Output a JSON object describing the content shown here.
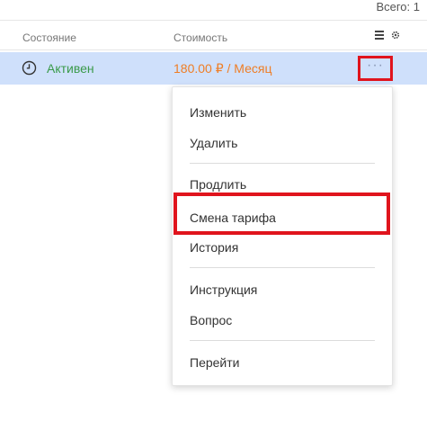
{
  "summary": {
    "total_label": "Всего: 1"
  },
  "table": {
    "headers": {
      "state": "Состояние",
      "cost": "Стоимость"
    },
    "rows": [
      {
        "status": "Активен",
        "price": "180.00 ₽ / Месяц"
      }
    ]
  },
  "row_actions": {
    "more_label": "···"
  },
  "context_menu": {
    "items": [
      "Изменить",
      "Удалить",
      "Продлить",
      "Смена тарифа",
      "История",
      "Инструкция",
      "Вопрос",
      "Перейти"
    ],
    "highlighted_item": "Смена тарифа"
  },
  "colors": {
    "status_active": "#3a9a4a",
    "price": "#ef7d25",
    "row_selected_bg": "#cfe0fb",
    "annotation_red": "#e0141d"
  },
  "icons": {
    "status": "clock-icon",
    "columns": "columns-icon",
    "settings": "gear-icon",
    "more": "more-dots-icon"
  }
}
